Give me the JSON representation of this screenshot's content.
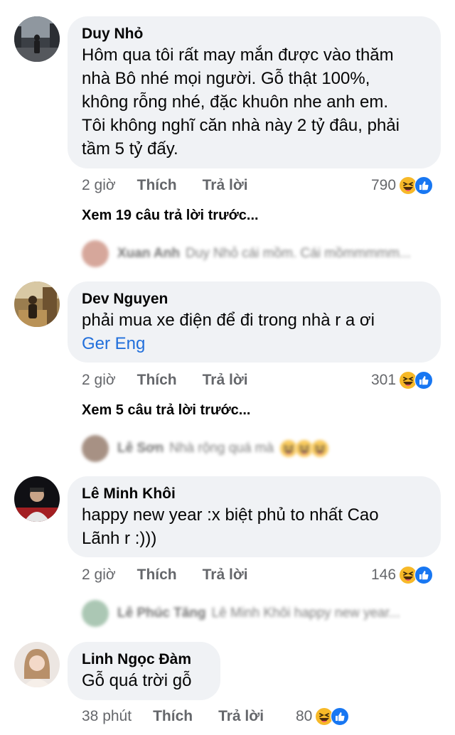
{
  "comments": [
    {
      "name": "Duy Nhỏ",
      "lines": [
        "Hôm qua tôi rất may mắn được vào thăm",
        "nhà Bô nhé mọi người. Gỗ thật 100%,",
        "không rỗng nhé, đặc khuôn nhe anh em.",
        "Tôi không nghĩ căn nhà này 2 tỷ đâu, phải",
        "tầm 5 tỷ đấy."
      ],
      "time": "2 giờ",
      "like": "Thích",
      "reply": "Trả lời",
      "reactions": "790",
      "view_more": "Xem 19 câu trả lời trước...",
      "reply_preview": {
        "name": "Xuan Anh",
        "text": "Duy Nhỏ cái mồm. Cái mồmmmmm..."
      }
    },
    {
      "name": "Dev Nguyen",
      "lines": [
        "phải mua xe điện để đi trong nhà r a ơi"
      ],
      "translate": "Ger Eng",
      "time": "2 giờ",
      "like": "Thích",
      "reply": "Trả lời",
      "reactions": "301",
      "view_more": "Xem 5 câu trả lời trước...",
      "reply_preview": {
        "name": "Lê Sơn",
        "text": "Nhà rộng quá mà"
      }
    },
    {
      "name": "Lê Minh Khôi",
      "lines": [
        "happy new year :x biệt phủ to nhất Cao",
        "Lãnh r :)))"
      ],
      "time": "2 giờ",
      "like": "Thích",
      "reply": "Trả lời",
      "reactions": "146",
      "reply_preview": {
        "name": "Lê Phúc Tăng",
        "text": "Lê Minh Khôi happy new year..."
      }
    },
    {
      "name": "Linh Ngọc Đàm",
      "lines": [
        "Gỗ quá trời gỗ"
      ],
      "time": "38 phút",
      "like": "Thích",
      "reply": "Trả lời",
      "reactions": "80"
    }
  ],
  "colors": {
    "bubble": "#f0f2f5",
    "link": "#216fdb",
    "meta": "#65676b",
    "like_blue": "#1877f2",
    "haha_yellow": "#f7b928"
  }
}
